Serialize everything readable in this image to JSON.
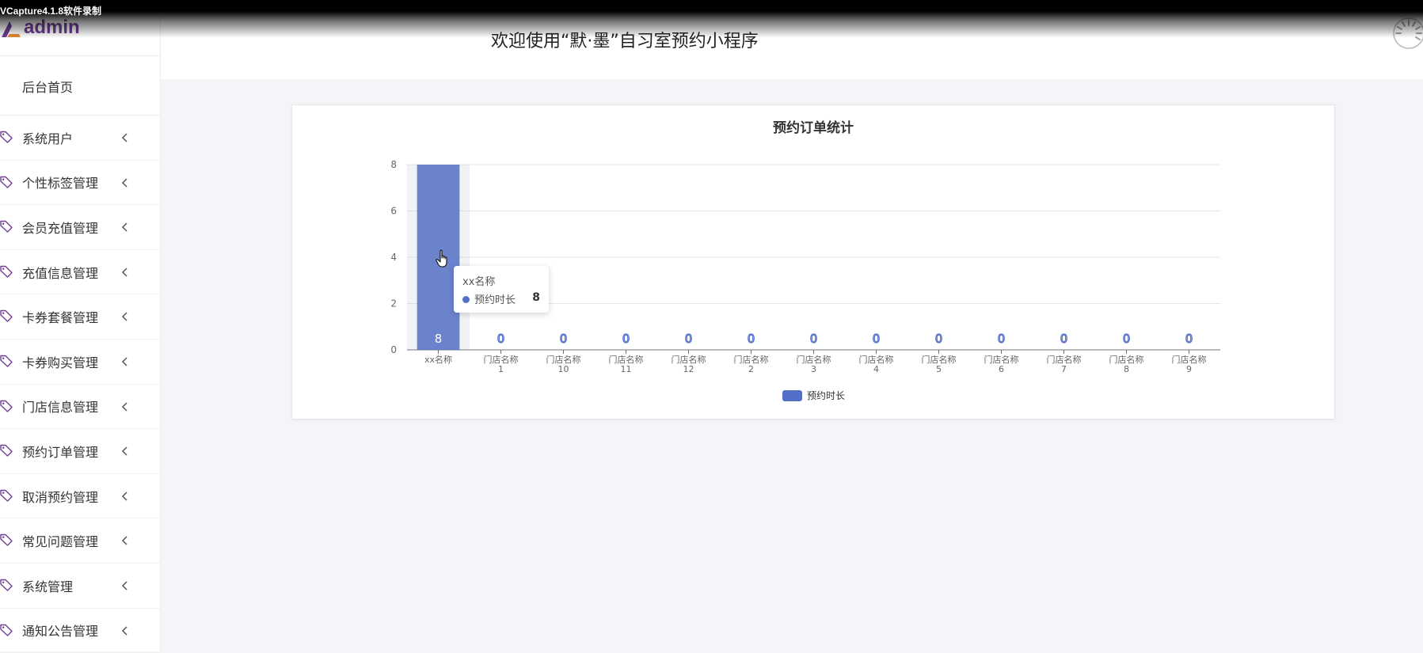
{
  "watermark": "VCapture4.1.8软件录制",
  "logo": {
    "text": "admin"
  },
  "header": {
    "title": "欢迎使用“默·墨”自习室预约小程序"
  },
  "sidebar": {
    "home": "后台首页",
    "items": [
      {
        "label": "系统用户"
      },
      {
        "label": "个性标签管理"
      },
      {
        "label": "会员充值管理"
      },
      {
        "label": "充值信息管理"
      },
      {
        "label": "卡券套餐管理"
      },
      {
        "label": "卡券购买管理"
      },
      {
        "label": "门店信息管理"
      },
      {
        "label": "预约订单管理"
      },
      {
        "label": "取消预约管理"
      },
      {
        "label": "常见问题管理"
      },
      {
        "label": "系统管理"
      },
      {
        "label": "通知公告管理"
      }
    ]
  },
  "icons": {
    "menu": "tag-icon",
    "expand": "chevron-left-icon",
    "loading": "spinner-icon"
  },
  "colors": {
    "accent": "#6f3d94",
    "bar": "#5470c6"
  },
  "tooltip": {
    "title": "xx名称",
    "series": "预约时长",
    "value": "8"
  },
  "chart_data": {
    "type": "bar",
    "title": "预约订单统计",
    "categories": [
      [
        "xx名称"
      ],
      [
        "门店名称",
        "1"
      ],
      [
        "门店名称",
        "10"
      ],
      [
        "门店名称",
        "11"
      ],
      [
        "门店名称",
        "12"
      ],
      [
        "门店名称",
        "2"
      ],
      [
        "门店名称",
        "3"
      ],
      [
        "门店名称",
        "4"
      ],
      [
        "门店名称",
        "5"
      ],
      [
        "门店名称",
        "6"
      ],
      [
        "门店名称",
        "7"
      ],
      [
        "门店名称",
        "8"
      ],
      [
        "门店名称",
        "9"
      ]
    ],
    "series": [
      {
        "name": "预约时长",
        "values": [
          8,
          0,
          0,
          0,
          0,
          0,
          0,
          0,
          0,
          0,
          0,
          0,
          0
        ]
      }
    ],
    "ylim": [
      0,
      8
    ],
    "yticks": [
      0,
      2,
      4,
      6,
      8
    ],
    "grid": true,
    "legend": "bottom-center"
  }
}
